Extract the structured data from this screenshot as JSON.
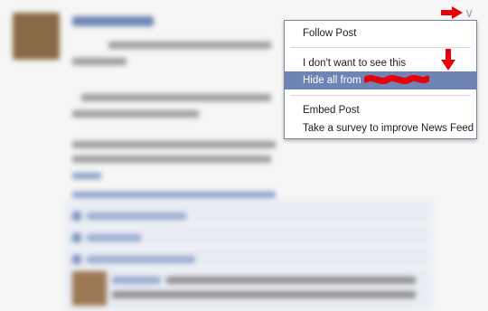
{
  "menu": {
    "items": [
      {
        "label": "Follow Post"
      },
      {
        "label": "I don't want to see this"
      },
      {
        "label": "Hide all from"
      },
      {
        "label": "Embed Post"
      },
      {
        "label": "Take a survey to improve News Feed"
      }
    ]
  },
  "icons": [
    "chevron-down-icon",
    "red-arrow-right-icon",
    "red-arrow-down-icon"
  ],
  "colors": {
    "highlight": "#6d84b4",
    "annotation": "#e8000a",
    "menu_border": "#7a84a0"
  }
}
